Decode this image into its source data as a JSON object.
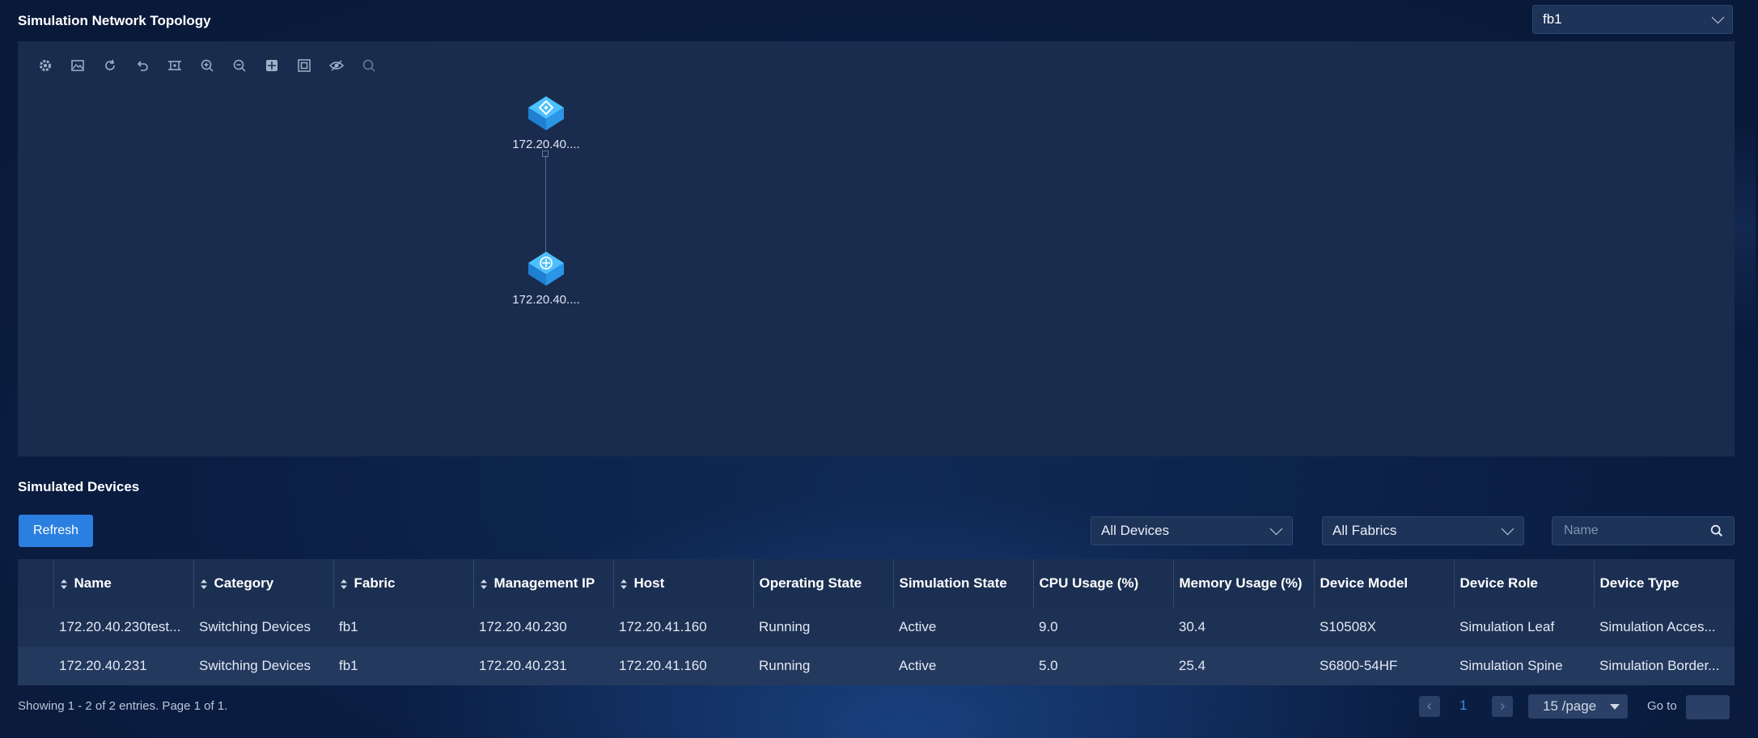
{
  "header": {
    "title": "Simulation Network Topology",
    "fabric_selected": "fb1"
  },
  "topology": {
    "toolbar": [
      {
        "name": "settings-icon"
      },
      {
        "name": "image-icon"
      },
      {
        "name": "refresh-icon"
      },
      {
        "name": "undo-icon"
      },
      {
        "name": "fit-view-icon"
      },
      {
        "name": "zoom-in-icon"
      },
      {
        "name": "zoom-out-icon"
      },
      {
        "name": "layout-icon"
      },
      {
        "name": "fullscreen-icon"
      },
      {
        "name": "hide-icon"
      },
      {
        "name": "search-icon"
      }
    ],
    "nodes": [
      {
        "label": "172.20.40....",
        "type": "spine-switch"
      },
      {
        "label": "172.20.40....",
        "type": "leaf-switch"
      }
    ]
  },
  "devices": {
    "title": "Simulated Devices",
    "refresh_label": "Refresh",
    "filter_devices": "All Devices",
    "filter_fabrics": "All Fabrics",
    "search_placeholder": "Name",
    "columns": {
      "name": "Name",
      "category": "Category",
      "fabric": "Fabric",
      "mgmt_ip": "Management IP",
      "host": "Host",
      "op_state": "Operating State",
      "sim_state": "Simulation State",
      "cpu": "CPU Usage (%)",
      "mem": "Memory Usage (%)",
      "model": "Device Model",
      "role": "Device Role",
      "type": "Device Type"
    },
    "rows": [
      {
        "name": "172.20.40.230test...",
        "category": "Switching Devices",
        "fabric": "fb1",
        "mgmt_ip": "172.20.40.230",
        "host": "172.20.41.160",
        "op_state": "Running",
        "sim_state": "Active",
        "cpu": "9.0",
        "mem": "30.4",
        "model": "S10508X",
        "role": "Simulation Leaf",
        "type": "Simulation Acces..."
      },
      {
        "name": "172.20.40.231",
        "category": "Switching Devices",
        "fabric": "fb1",
        "mgmt_ip": "172.20.40.231",
        "host": "172.20.41.160",
        "op_state": "Running",
        "sim_state": "Active",
        "cpu": "5.0",
        "mem": "25.4",
        "model": "S6800-54HF",
        "role": "Simulation Spine",
        "type": "Simulation Border..."
      }
    ]
  },
  "pagination": {
    "summary": "Showing 1 - 2 of 2 entries. Page 1 of 1.",
    "current_page": "1",
    "page_size": "15 /page",
    "goto_label": "Go to"
  },
  "colors": {
    "accent": "#2b7fe0",
    "panel": "#1a2c4e",
    "node": "#3aa8f0"
  }
}
